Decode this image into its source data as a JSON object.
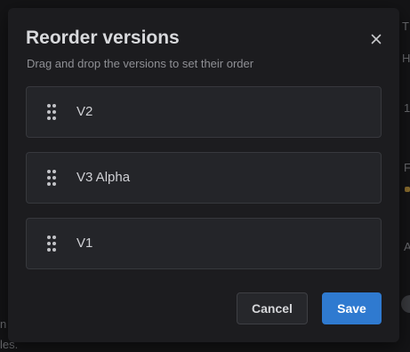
{
  "dialog": {
    "title": "Reorder versions",
    "subtitle": "Drag and drop the versions to set their order",
    "close_icon": "close-icon"
  },
  "versions": [
    {
      "label": "V2"
    },
    {
      "label": "V3 Alpha"
    },
    {
      "label": "V1"
    }
  ],
  "actions": {
    "cancel_label": "Cancel",
    "save_label": "Save"
  },
  "background_fragments": [
    "T",
    "H",
    "1",
    "F",
    "A",
    "n",
    "les."
  ],
  "colors": {
    "accent": "#2f7ad0",
    "modal_bg": "#1c1c1f",
    "item_bg": "#242529"
  }
}
